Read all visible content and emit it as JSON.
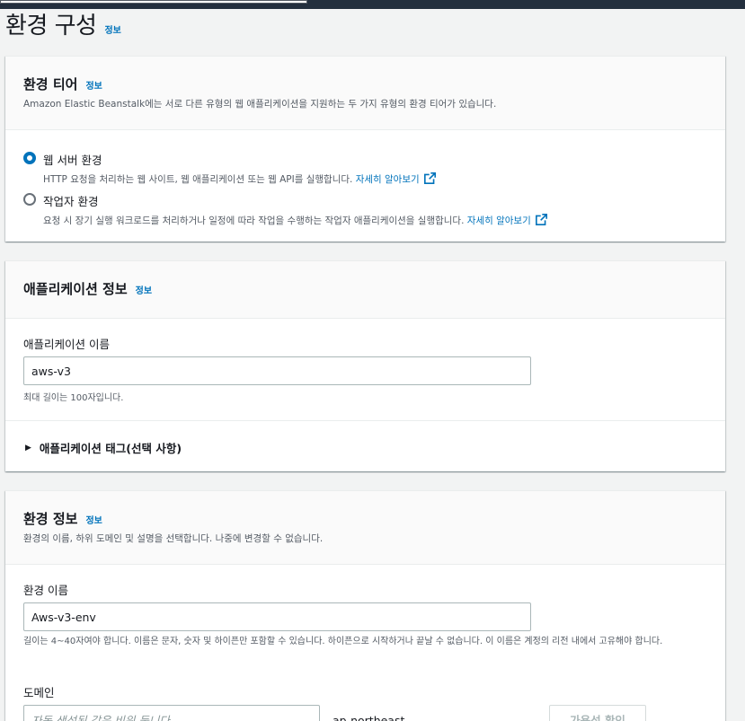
{
  "page": {
    "title": "환경 구성",
    "info": "정보"
  },
  "tier": {
    "title": "환경 티어",
    "info": "정보",
    "description": "Amazon Elastic Beanstalk에는 서로 다른 유형의 웹 애플리케이션을 지원하는 두 가지 유형의 환경 티어가 있습니다.",
    "options": [
      {
        "label": "웹 서버 환경",
        "description": "HTTP 요청을 처리하는 웹 사이트, 웹 애플리케이션 또는 웹 API를 실행합니다.",
        "learn_more": "자세히 알아보기",
        "selected": true
      },
      {
        "label": "작업자 환경",
        "description": "요청 시 장기 실행 워크로드를 처리하거나 일정에 따라 작업을 수행하는 작업자 애플리케이션을 실행합니다.",
        "learn_more": "자세히 알아보기",
        "selected": false
      }
    ]
  },
  "application": {
    "title": "애플리케이션 정보",
    "info": "정보",
    "name_label": "애플리케이션 이름",
    "name_value": "aws-v3",
    "name_constraint": "최대 길이는 100자입니다.",
    "tags_label": "애플리케이션 태그(선택 사항)"
  },
  "environment": {
    "title": "환경 정보",
    "info": "정보",
    "description": "환경의 이름, 하위 도메인 및 설명을 선택합니다. 나중에 변경할 수 없습니다.",
    "name_label": "환경 이름",
    "name_value": "Aws-v3-env",
    "name_constraint": "길이는 4~40자여야 합니다. 이름은 문자, 숫자 및 하이픈만 포함할 수 있습니다. 하이픈으로 시작하거나 끝날 수 없습니다. 이 이름은 계정의 리전 내에서 고유해야 합니다.",
    "domain_label": "도메인",
    "domain_placeholder": "자동 생성된 값은 비워 둡니다",
    "domain_suffix": ".ap-northeast-",
    "check_button": "가용성 확인"
  },
  "colors": {
    "link": "#0073bb",
    "radio_selected": "#0073bb",
    "topbar": "#232f3e"
  },
  "icons": {
    "external_link": "external-link-icon",
    "caret": "caret-right-icon"
  }
}
